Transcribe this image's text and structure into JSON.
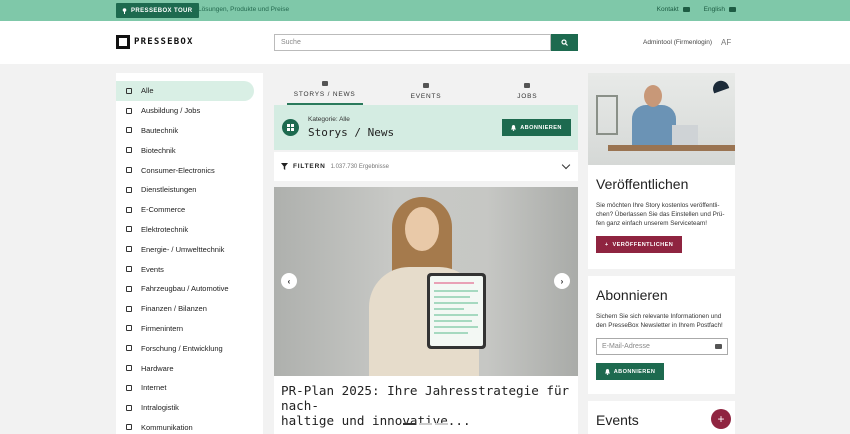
{
  "topbar": {
    "tour_label": "PRESSEBOX TOUR",
    "tagline": "Lösungen, Produkte und Preise",
    "contact": "Kontakt",
    "language": "English"
  },
  "header": {
    "logo": "PRESSEBOX",
    "search_placeholder": "Suche",
    "login": "Admintool (Firmenlogin)",
    "initials": "AF"
  },
  "sidebar": {
    "items": [
      "Alle",
      "Ausbildung / Jobs",
      "Bautechnik",
      "Biotechnik",
      "Consumer-Electronics",
      "Dienstleistungen",
      "E-Commerce",
      "Elektrotechnik",
      "Energie- / Umwelttechnik",
      "Events",
      "Fahrzeugbau / Automotive",
      "Finanzen / Bilanzen",
      "Firmenintern",
      "Forschung / Entwicklung",
      "Hardware",
      "Internet",
      "Intralogistik",
      "Kommunikation"
    ]
  },
  "tabs": [
    "STORYS / NEWS",
    "EVENTS",
    "JOBS"
  ],
  "category": {
    "label": "Kategorie: Alle",
    "title": "Storys / News",
    "subscribe": "ABONNIEREN"
  },
  "filter": {
    "label": "FILTERN",
    "count": "1.037.730 Ergebnisse"
  },
  "hero": {
    "title_line1": "PR-Plan 2025: Ihre Jahresstrategie für nach-",
    "title_line2": "haltige und innovative..."
  },
  "publish": {
    "title": "Veröffentlichen",
    "text_line1": "Sie möchten Ihre Story kostenlos veröffentli-",
    "text_line2": "chen? Überlassen Sie das Einstellen und Prü-",
    "text_line3": "fen ganz einfach unserem Serviceteam!",
    "button": "VERÖFFENTLICHEN"
  },
  "subscribe": {
    "title": "Abonnieren",
    "text_line1": "Sichern Sie sich relevante Informationen und",
    "text_line2": "den PresseBox Newsletter in Ihrem Postfach!",
    "email_placeholder": "E-Mail-Adresse",
    "button": "ABONNIEREN"
  },
  "events": {
    "title": "Events",
    "add": "+"
  }
}
